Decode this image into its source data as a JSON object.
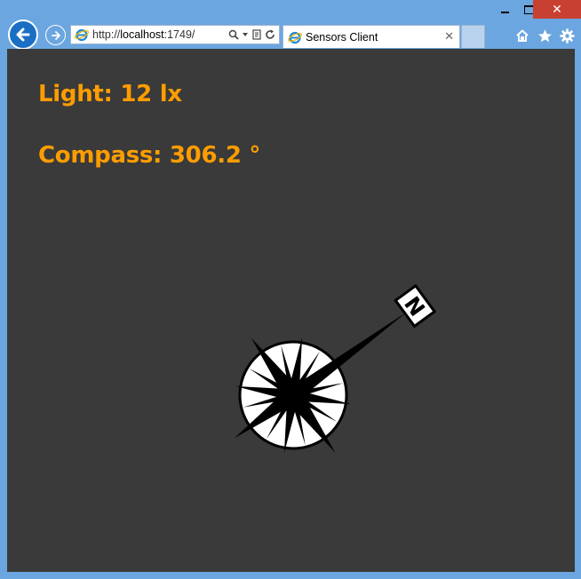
{
  "window": {
    "minimize_glyph": "minimize-icon",
    "maximize_glyph": "maximize-icon",
    "close_glyph": "✕"
  },
  "address_bar": {
    "url_prefix": "http://",
    "url_host": "localhost",
    "url_suffix": ":1749/"
  },
  "tab": {
    "title": "Sensors Client",
    "close": "✕"
  },
  "readings": {
    "light": "Light: 12 lx",
    "compass": "Compass: 306.2 °"
  },
  "compass_rose": {
    "heading_degrees": 306.2,
    "north_label": "N"
  },
  "colors": {
    "accent": "#ff9d00",
    "background": "#3a3a3a",
    "chrome": "#6ba6e0",
    "close_button": "#c84031"
  }
}
